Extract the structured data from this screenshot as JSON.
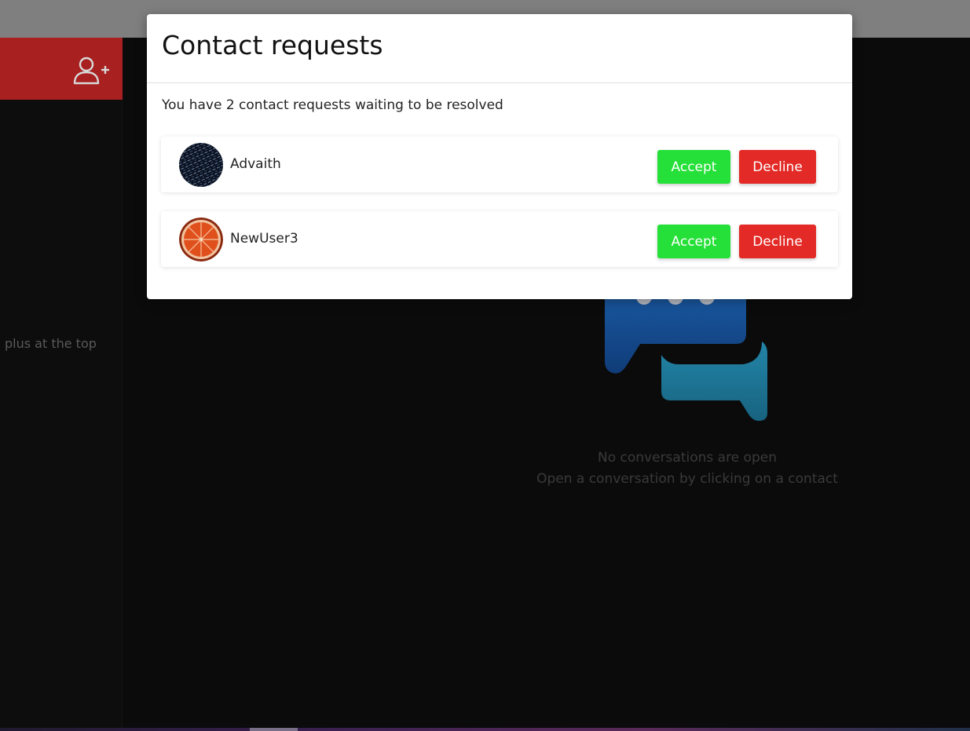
{
  "sidebar": {
    "hint_text": "plus at the top",
    "add_contact_icon": "user-plus-icon",
    "header_color": "#a82020"
  },
  "main": {
    "empty_title": "No conversations are open",
    "empty_subtitle": "Open a conversation by clicking on a contact",
    "illustration": "chat-bubbles-icon"
  },
  "modal": {
    "title": "Contact requests",
    "summary": "You have 2 contact requests waiting to be resolved",
    "requests": [
      {
        "name": "Advaith",
        "avatar": "dark-noise-avatar",
        "accept_label": "Accept",
        "decline_label": "Decline"
      },
      {
        "name": "NewUser3",
        "avatar": "orange-slice-avatar",
        "accept_label": "Accept",
        "decline_label": "Decline"
      }
    ]
  },
  "colors": {
    "accept": "#25e038",
    "decline": "#e32a26",
    "topbar": "#7f7f7f",
    "background": "#0b0b0c"
  }
}
